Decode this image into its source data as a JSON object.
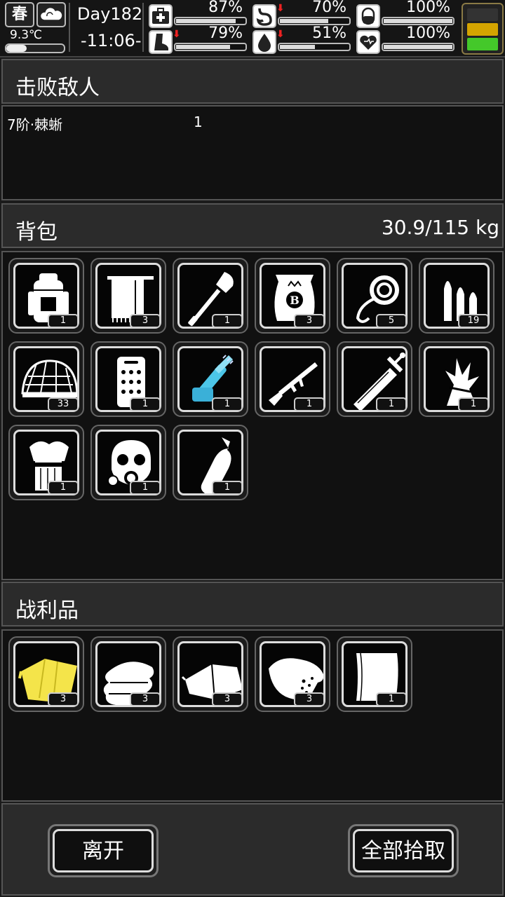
{
  "status": {
    "season": "春",
    "weather_icon": "cloud-icon",
    "temperature": "9.3℃",
    "temperature_level": 0.35,
    "day": "Day182",
    "clock": "-11:06-",
    "stats": [
      {
        "name": "health",
        "icon": "medkit-icon",
        "pct": "87%",
        "value": 0.87,
        "falling": false
      },
      {
        "name": "hunger",
        "icon": "stomach-icon",
        "pct": "70%",
        "value": 0.7,
        "falling": true
      },
      {
        "name": "medicine",
        "icon": "pill-icon",
        "pct": "100%",
        "value": 1.0,
        "falling": false
      },
      {
        "name": "stamina",
        "icon": "foot-icon",
        "pct": "79%",
        "value": 0.79,
        "falling": true
      },
      {
        "name": "thirst",
        "icon": "water-drop-icon",
        "pct": "51%",
        "value": 0.51,
        "falling": true
      },
      {
        "name": "mood",
        "icon": "heart-icon",
        "pct": "100%",
        "value": 1.0,
        "falling": false
      }
    ],
    "battery_colors": [
      "#333333",
      "#d4a400",
      "#44c82a"
    ]
  },
  "defeated": {
    "title": "击败敌人",
    "rows": [
      {
        "name": "7阶·棘蜥",
        "count": "1"
      }
    ]
  },
  "backpack": {
    "title": "背包",
    "weight": "30.9/115 kg",
    "items": [
      {
        "icon": "backpack-icon",
        "count": "1"
      },
      {
        "icon": "towel-icon",
        "count": "3"
      },
      {
        "icon": "shovel-icon",
        "count": "1"
      },
      {
        "icon": "sack-icon",
        "count": "3"
      },
      {
        "icon": "rope-icon",
        "count": "5"
      },
      {
        "icon": "bullets-icon",
        "count": "19"
      },
      {
        "icon": "net-icon",
        "count": "33"
      },
      {
        "icon": "armor-plate-icon",
        "count": "1"
      },
      {
        "icon": "chainsaw-icon",
        "count": "1"
      },
      {
        "icon": "rifle-icon",
        "count": "1"
      },
      {
        "icon": "sword-icon",
        "count": "1"
      },
      {
        "icon": "straw-icon",
        "count": "1"
      },
      {
        "icon": "hay-bundle-icon",
        "count": "1"
      },
      {
        "icon": "gas-mask-icon",
        "count": "1"
      },
      {
        "icon": "bottle-icon",
        "count": "1"
      }
    ]
  },
  "loot": {
    "title": "战利品",
    "items": [
      {
        "icon": "yellow-cloth-icon",
        "count": "3"
      },
      {
        "icon": "folded-cloth-icon",
        "count": "3"
      },
      {
        "icon": "leather-icon",
        "count": "3"
      },
      {
        "icon": "meat-icon",
        "count": "3"
      },
      {
        "icon": "paper-icon",
        "count": "1"
      }
    ]
  },
  "buttons": {
    "leave": "离开",
    "take_all": "全部拾取"
  }
}
